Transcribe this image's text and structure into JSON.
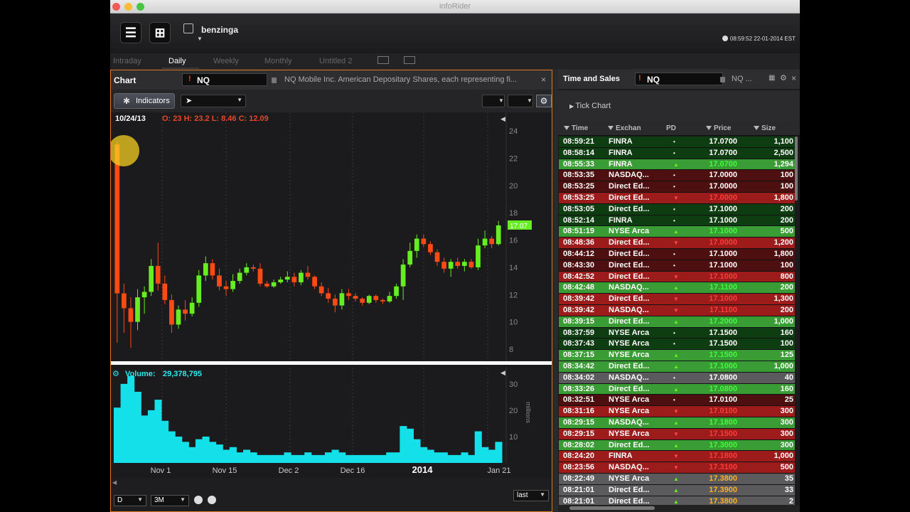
{
  "window": {
    "title": "infoRider"
  },
  "topbar": {
    "brand": "benzinga",
    "clock": "08:59:52 22-01-2014 EST"
  },
  "tabs": [
    "Intraday",
    "Daily",
    "Weekly",
    "Monthly",
    "Untitled 2"
  ],
  "chart_panel": {
    "title": "Chart",
    "symbol": "NQ",
    "description": "NQ Mobile Inc. American Depositary Shares, each representing fi...",
    "indicators_label": "Indicators",
    "cursor_label": "",
    "date": "10/24/13",
    "ohlc": "O: 23 H: 23.2 L: 8.46 C: 12.09",
    "last_price_label": "17.07",
    "volume_label": "Volume:",
    "volume_value": "29,378,795",
    "volume_unit": "millions",
    "footer": {
      "period": "D",
      "range": "3M",
      "mode": "last"
    }
  },
  "chart_data": {
    "type": "candlestick",
    "price_axis": {
      "min": 8,
      "max": 24,
      "ticks": [
        24,
        22,
        20,
        18,
        16,
        14,
        12,
        10,
        8
      ]
    },
    "volume_axis": {
      "unit": "millions",
      "ticks": [
        30,
        20,
        10
      ]
    },
    "date_labels": [
      "Nov 1",
      "Nov 15",
      "Dec 2",
      "Dec 16",
      "2014",
      "Jan 21"
    ],
    "last_price": 17.07,
    "candles": [
      {
        "o": 23,
        "h": 23.2,
        "l": 8.46,
        "c": 12.09,
        "v": 21
      },
      {
        "o": 12.09,
        "h": 12.8,
        "l": 9.2,
        "c": 11.0,
        "v": 30
      },
      {
        "o": 11.0,
        "h": 11.8,
        "l": 8.1,
        "c": 10.0,
        "v": 33
      },
      {
        "o": 10.0,
        "h": 12.4,
        "l": 9.4,
        "c": 11.8,
        "v": 27
      },
      {
        "o": 11.8,
        "h": 12.6,
        "l": 10.6,
        "c": 12.2,
        "v": 18
      },
      {
        "o": 12.2,
        "h": 14.6,
        "l": 11.9,
        "c": 14.1,
        "v": 20
      },
      {
        "o": 14.1,
        "h": 15.8,
        "l": 12.3,
        "c": 12.8,
        "v": 24
      },
      {
        "o": 12.8,
        "h": 13.4,
        "l": 11.3,
        "c": 11.6,
        "v": 16
      },
      {
        "o": 11.6,
        "h": 12.0,
        "l": 9.2,
        "c": 9.8,
        "v": 12
      },
      {
        "o": 9.8,
        "h": 11.2,
        "l": 9.5,
        "c": 10.9,
        "v": 10
      },
      {
        "o": 10.9,
        "h": 11.6,
        "l": 10.1,
        "c": 10.6,
        "v": 8
      },
      {
        "o": 10.6,
        "h": 11.8,
        "l": 10.4,
        "c": 11.4,
        "v": 6
      },
      {
        "o": 11.4,
        "h": 13.8,
        "l": 11.1,
        "c": 13.4,
        "v": 9
      },
      {
        "o": 13.4,
        "h": 14.8,
        "l": 13.0,
        "c": 14.3,
        "v": 10
      },
      {
        "o": 14.3,
        "h": 14.6,
        "l": 13.1,
        "c": 13.4,
        "v": 8
      },
      {
        "o": 13.4,
        "h": 13.9,
        "l": 12.3,
        "c": 12.6,
        "v": 7
      },
      {
        "o": 12.6,
        "h": 13.0,
        "l": 11.9,
        "c": 12.4,
        "v": 5
      },
      {
        "o": 12.4,
        "h": 13.5,
        "l": 12.2,
        "c": 13.0,
        "v": 6
      },
      {
        "o": 13.0,
        "h": 13.9,
        "l": 12.8,
        "c": 13.6,
        "v": 4
      },
      {
        "o": 13.6,
        "h": 14.3,
        "l": 13.4,
        "c": 14.0,
        "v": 5
      },
      {
        "o": 14.0,
        "h": 14.2,
        "l": 13.7,
        "c": 13.9,
        "v": 4
      },
      {
        "o": 13.9,
        "h": 14.3,
        "l": 12.6,
        "c": 12.8,
        "v": 3
      },
      {
        "o": 12.8,
        "h": 13.0,
        "l": 12.5,
        "c": 12.6,
        "v": 3
      },
      {
        "o": 12.6,
        "h": 13.1,
        "l": 12.5,
        "c": 12.9,
        "v": 3
      },
      {
        "o": 12.9,
        "h": 13.3,
        "l": 12.8,
        "c": 13.1,
        "v": 3
      },
      {
        "o": 13.1,
        "h": 13.7,
        "l": 12.9,
        "c": 13.3,
        "v": 4
      },
      {
        "o": 13.3,
        "h": 13.6,
        "l": 12.6,
        "c": 12.9,
        "v": 3
      },
      {
        "o": 12.9,
        "h": 13.8,
        "l": 12.7,
        "c": 13.6,
        "v": 3
      },
      {
        "o": 13.6,
        "h": 14.1,
        "l": 13.1,
        "c": 13.3,
        "v": 4
      },
      {
        "o": 13.3,
        "h": 13.4,
        "l": 12.4,
        "c": 12.6,
        "v": 3
      },
      {
        "o": 12.6,
        "h": 12.9,
        "l": 11.9,
        "c": 12.1,
        "v": 3
      },
      {
        "o": 12.1,
        "h": 12.5,
        "l": 11.4,
        "c": 11.7,
        "v": 4
      },
      {
        "o": 11.7,
        "h": 12.0,
        "l": 10.7,
        "c": 11.2,
        "v": 5
      },
      {
        "o": 11.2,
        "h": 12.4,
        "l": 10.9,
        "c": 12.1,
        "v": 4
      },
      {
        "o": 12.1,
        "h": 12.4,
        "l": 11.6,
        "c": 11.9,
        "v": 3
      },
      {
        "o": 11.9,
        "h": 12.1,
        "l": 11.5,
        "c": 11.7,
        "v": 3
      },
      {
        "o": 11.7,
        "h": 11.8,
        "l": 11.2,
        "c": 11.4,
        "v": 3
      },
      {
        "o": 11.4,
        "h": 12.0,
        "l": 11.3,
        "c": 11.9,
        "v": 3
      },
      {
        "o": 11.9,
        "h": 12.0,
        "l": 11.4,
        "c": 11.6,
        "v": 3
      },
      {
        "o": 11.6,
        "h": 11.7,
        "l": 11.3,
        "c": 11.5,
        "v": 3
      },
      {
        "o": 11.5,
        "h": 12.2,
        "l": 11.4,
        "c": 11.9,
        "v": 4
      },
      {
        "o": 11.9,
        "h": 12.8,
        "l": 11.7,
        "c": 12.6,
        "v": 4
      },
      {
        "o": 12.6,
        "h": 14.6,
        "l": 11.6,
        "c": 14.2,
        "v": 14
      },
      {
        "o": 14.2,
        "h": 15.8,
        "l": 14.0,
        "c": 15.2,
        "v": 13
      },
      {
        "o": 15.2,
        "h": 16.4,
        "l": 14.7,
        "c": 16.1,
        "v": 9
      },
      {
        "o": 16.1,
        "h": 16.4,
        "l": 15.5,
        "c": 15.7,
        "v": 6
      },
      {
        "o": 15.7,
        "h": 15.9,
        "l": 14.9,
        "c": 15.1,
        "v": 5
      },
      {
        "o": 15.1,
        "h": 15.3,
        "l": 14.1,
        "c": 14.4,
        "v": 4
      },
      {
        "o": 14.4,
        "h": 14.7,
        "l": 13.6,
        "c": 13.9,
        "v": 4
      },
      {
        "o": 13.9,
        "h": 14.6,
        "l": 13.3,
        "c": 14.4,
        "v": 3
      },
      {
        "o": 14.4,
        "h": 14.7,
        "l": 13.9,
        "c": 14.1,
        "v": 3
      },
      {
        "o": 14.1,
        "h": 14.6,
        "l": 13.7,
        "c": 14.4,
        "v": 4
      },
      {
        "o": 14.4,
        "h": 14.6,
        "l": 13.9,
        "c": 14.0,
        "v": 3
      },
      {
        "o": 14.0,
        "h": 16.1,
        "l": 13.8,
        "c": 15.6,
        "v": 12
      },
      {
        "o": 15.6,
        "h": 16.7,
        "l": 15.4,
        "c": 16.1,
        "v": 6
      },
      {
        "o": 16.1,
        "h": 16.3,
        "l": 15.4,
        "c": 15.7,
        "v": 5
      },
      {
        "o": 15.7,
        "h": 17.4,
        "l": 15.6,
        "c": 17.07,
        "v": 8
      }
    ]
  },
  "ts_panel": {
    "title": "Time and Sales",
    "symbol": "NQ",
    "symbol_desc": "NQ ...",
    "subheader": "Tick Chart",
    "columns": [
      "Time",
      "Exchan",
      "PD",
      "Price",
      "Size"
    ],
    "colors": {
      "up_dark": "#0f3d12",
      "up_bright": "#3a9c34",
      "down_dark": "#4d0f0f",
      "down_bright": "#9c1c1c",
      "neutral": "#5b5b5d"
    },
    "rows": [
      {
        "t": "08:59:21",
        "ex": "FINRA",
        "pd": "•",
        "p": "17.0700",
        "s": "1,100",
        "c": "g0",
        "pc": "#fff"
      },
      {
        "t": "08:58:14",
        "ex": "FINRA",
        "pd": "•",
        "p": "17.0700",
        "s": "2,500",
        "c": "g0",
        "pc": "#fff"
      },
      {
        "t": "08:55:33",
        "ex": "FINRA",
        "pd": "▲",
        "p": "17.0700",
        "s": "1,294",
        "c": "g1",
        "pc": "#3aff3a"
      },
      {
        "t": "08:53:35",
        "ex": "NASDAQ...",
        "pd": "•",
        "p": "17.0000",
        "s": "100",
        "c": "r0",
        "pc": "#fff"
      },
      {
        "t": "08:53:25",
        "ex": "Direct Ed...",
        "pd": "•",
        "p": "17.0000",
        "s": "100",
        "c": "r0",
        "pc": "#fff"
      },
      {
        "t": "08:53:25",
        "ex": "Direct Ed...",
        "pd": "▼",
        "p": "17.0000",
        "s": "1,800",
        "c": "r1",
        "pc": "#ff3a3a"
      },
      {
        "t": "08:53:05",
        "ex": "Direct Ed...",
        "pd": "•",
        "p": "17.1000",
        "s": "200",
        "c": "g0",
        "pc": "#fff"
      },
      {
        "t": "08:52:14",
        "ex": "FINRA",
        "pd": "•",
        "p": "17.1000",
        "s": "200",
        "c": "g0",
        "pc": "#fff"
      },
      {
        "t": "08:51:19",
        "ex": "NYSE Arca",
        "pd": "▲",
        "p": "17.1000",
        "s": "500",
        "c": "g1",
        "pc": "#3aff3a"
      },
      {
        "t": "08:48:36",
        "ex": "Direct Ed...",
        "pd": "▼",
        "p": "17.0000",
        "s": "1,200",
        "c": "r1",
        "pc": "#ff3a3a"
      },
      {
        "t": "08:44:12",
        "ex": "Direct Ed...",
        "pd": "•",
        "p": "17.1000",
        "s": "1,800",
        "c": "r0",
        "pc": "#fff"
      },
      {
        "t": "08:43:30",
        "ex": "Direct Ed...",
        "pd": "•",
        "p": "17.1000",
        "s": "100",
        "c": "r0",
        "pc": "#fff"
      },
      {
        "t": "08:42:52",
        "ex": "Direct Ed...",
        "pd": "▼",
        "p": "17.1000",
        "s": "800",
        "c": "r1",
        "pc": "#ff3a3a"
      },
      {
        "t": "08:42:48",
        "ex": "NASDAQ...",
        "pd": "▲",
        "p": "17.1100",
        "s": "200",
        "c": "g1",
        "pc": "#3aff3a"
      },
      {
        "t": "08:39:42",
        "ex": "Direct Ed...",
        "pd": "▼",
        "p": "17.1000",
        "s": "1,300",
        "c": "r1",
        "pc": "#ff3a3a"
      },
      {
        "t": "08:39:42",
        "ex": "NASDAQ...",
        "pd": "▼",
        "p": "17.1100",
        "s": "200",
        "c": "r1",
        "pc": "#ff3a3a"
      },
      {
        "t": "08:39:15",
        "ex": "Direct Ed...",
        "pd": "▲",
        "p": "17.2000",
        "s": "1,000",
        "c": "g1",
        "pc": "#3aff3a"
      },
      {
        "t": "08:37:59",
        "ex": "NYSE Arca",
        "pd": "•",
        "p": "17.1500",
        "s": "160",
        "c": "g0",
        "pc": "#fff"
      },
      {
        "t": "08:37:43",
        "ex": "NYSE Arca",
        "pd": "•",
        "p": "17.1500",
        "s": "100",
        "c": "g0",
        "pc": "#fff"
      },
      {
        "t": "08:37:15",
        "ex": "NYSE Arca",
        "pd": "▲",
        "p": "17.1500",
        "s": "125",
        "c": "g1",
        "pc": "#3aff3a"
      },
      {
        "t": "08:34:42",
        "ex": "Direct Ed...",
        "pd": "▲",
        "p": "17.1000",
        "s": "1,000",
        "c": "g1",
        "pc": "#3aff3a"
      },
      {
        "t": "08:34:02",
        "ex": "NASDAQ...",
        "pd": "•",
        "p": "17.0800",
        "s": "40",
        "c": "n0",
        "pc": "#fff"
      },
      {
        "t": "08:33:26",
        "ex": "Direct Ed...",
        "pd": "▲",
        "p": "17.0800",
        "s": "160",
        "c": "g1",
        "pc": "#3aff3a"
      },
      {
        "t": "08:32:51",
        "ex": "NYSE Arca",
        "pd": "•",
        "p": "17.0100",
        "s": "25",
        "c": "r0",
        "pc": "#fff"
      },
      {
        "t": "08:31:16",
        "ex": "NYSE Arca",
        "pd": "▼",
        "p": "17.0100",
        "s": "300",
        "c": "r1",
        "pc": "#ff3a3a"
      },
      {
        "t": "08:29:15",
        "ex": "NASDAQ...",
        "pd": "▲",
        "p": "17.1800",
        "s": "300",
        "c": "g1",
        "pc": "#3aff3a"
      },
      {
        "t": "08:29:15",
        "ex": "NYSE Arca",
        "pd": "▼",
        "p": "17.1500",
        "s": "300",
        "c": "r1",
        "pc": "#ff3a3a"
      },
      {
        "t": "08:28:02",
        "ex": "Direct Ed...",
        "pd": "▲",
        "p": "17.3000",
        "s": "300",
        "c": "g1",
        "pc": "#3aff3a"
      },
      {
        "t": "08:24:20",
        "ex": "FINRA",
        "pd": "▼",
        "p": "17.1800",
        "s": "1,000",
        "c": "r1",
        "pc": "#ff3a3a"
      },
      {
        "t": "08:23:56",
        "ex": "NASDAQ...",
        "pd": "▼",
        "p": "17.3100",
        "s": "500",
        "c": "r1",
        "pc": "#ff3a3a"
      },
      {
        "t": "08:22:49",
        "ex": "NYSE Arca",
        "pd": "▲",
        "p": "17.3800",
        "s": "35",
        "c": "n0",
        "pc": "#ffb020"
      },
      {
        "t": "08:21:01",
        "ex": "Direct Ed...",
        "pd": "▲",
        "p": "17.3900",
        "s": "33",
        "c": "n0",
        "pc": "#ffb020"
      },
      {
        "t": "08:21:01",
        "ex": "Direct Ed...",
        "pd": "▲",
        "p": "17.3800",
        "s": "2",
        "c": "n0",
        "pc": "#ffb020"
      }
    ]
  }
}
